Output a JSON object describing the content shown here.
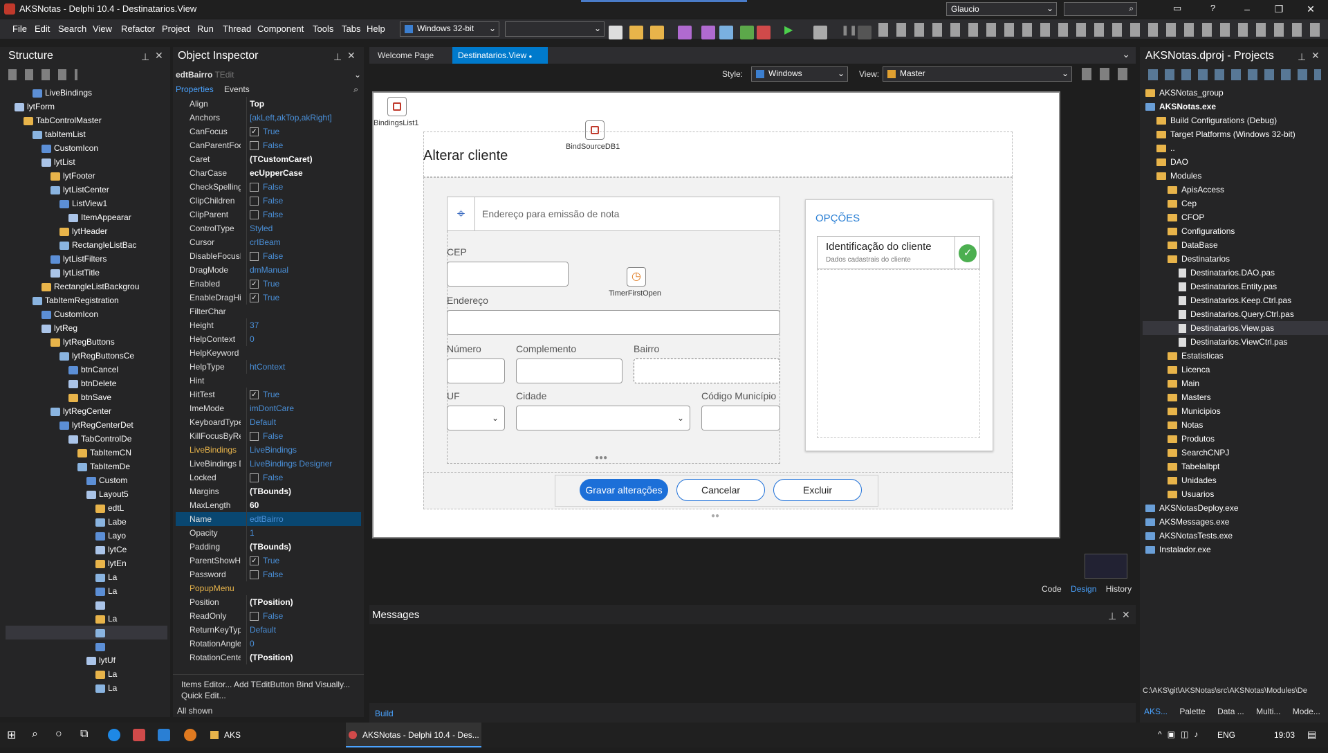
{
  "title_bar": {
    "title": "AKSNotas - Delphi 10.4 - Destinatarios.View",
    "user": "Glaucio",
    "search_placeholder": ""
  },
  "menu": [
    "File",
    "Edit",
    "Search",
    "View",
    "Refactor",
    "Project",
    "Run",
    "Thread",
    "Component",
    "Tools",
    "Tabs",
    "Help"
  ],
  "platform": "Windows 32-bit",
  "structure": {
    "title": "Structure",
    "items": [
      "LiveBindings",
      "lytForm",
      "TabControlMaster",
      "tabItemList",
      "CustomIcon",
      "lytList",
      "lytFooter",
      "lytListCenter",
      "ListView1",
      "ItemAppearar",
      "lytHeader",
      "RectangleListBac",
      "lytListFilters",
      "lytListTitle",
      "RectangleListBackgrou",
      "TabItemRegistration",
      "CustomIcon",
      "lytReg",
      "lytRegButtons",
      "lytRegButtonsCe",
      "btnCancel",
      "btnDelete",
      "btnSave",
      "lytRegCenter",
      "lytRegCenterDet",
      "TabControlDe",
      "TabItemCN",
      "TabItemDe",
      "Custom",
      "Layout5",
      "edtL",
      "Labe",
      "Layo",
      "lytCe",
      "lytEn",
      "La",
      "La",
      "",
      "La",
      "",
      "",
      "lytUf",
      "La",
      "La"
    ]
  },
  "object_inspector": {
    "title": "Object Inspector",
    "object_name": "edtBairro",
    "object_type": "TEdit",
    "tabs": [
      "Properties",
      "Events"
    ],
    "properties": [
      [
        "Align",
        "Top"
      ],
      [
        "Anchors",
        "[akLeft,akTop,akRight]"
      ],
      [
        "CanFocus",
        "True"
      ],
      [
        "CanParentFocus",
        "False"
      ],
      [
        "Caret",
        "(TCustomCaret)"
      ],
      [
        "CharCase",
        "ecUpperCase"
      ],
      [
        "CheckSpelling",
        "False"
      ],
      [
        "ClipChildren",
        "False"
      ],
      [
        "ClipParent",
        "False"
      ],
      [
        "ControlType",
        "Styled"
      ],
      [
        "Cursor",
        "crIBeam"
      ],
      [
        "DisableFocusEffe",
        "False"
      ],
      [
        "DragMode",
        "dmManual"
      ],
      [
        "Enabled",
        "True"
      ],
      [
        "EnableDragHighl",
        "True"
      ],
      [
        "FilterChar",
        ""
      ],
      [
        "Height",
        "37"
      ],
      [
        "HelpContext",
        "0"
      ],
      [
        "HelpKeyword",
        ""
      ],
      [
        "HelpType",
        "htContext"
      ],
      [
        "Hint",
        ""
      ],
      [
        "HitTest",
        "True"
      ],
      [
        "ImeMode",
        "imDontCare"
      ],
      [
        "KeyboardType",
        "Default"
      ],
      [
        "KillFocusByRetur",
        "False"
      ],
      [
        "LiveBindings",
        "LiveBindings"
      ],
      [
        "LiveBindings Des",
        "LiveBindings Designer"
      ],
      [
        "Locked",
        "False"
      ],
      [
        "Margins",
        "(TBounds)"
      ],
      [
        "MaxLength",
        "60"
      ],
      [
        "Name",
        "edtBairro"
      ],
      [
        "Opacity",
        "1"
      ],
      [
        "Padding",
        "(TBounds)"
      ],
      [
        "ParentShowHint",
        "True"
      ],
      [
        "Password",
        "False"
      ],
      [
        "PopupMenu",
        ""
      ],
      [
        "Position",
        "(TPosition)"
      ],
      [
        "ReadOnly",
        "False"
      ],
      [
        "ReturnKeyType",
        "Default"
      ],
      [
        "RotationAngle",
        "0"
      ],
      [
        "RotationCenter",
        "(TPosition)"
      ]
    ],
    "footer_links": "Items Editor... Add TEditButton Bind Visually...",
    "footer_link2": "Quick Edit...",
    "all_shown": "All shown"
  },
  "editor": {
    "tabs": [
      "Welcome Page",
      "Destinatarios.View"
    ],
    "style_label": "Style:",
    "style_value": "Windows",
    "view_label": "View:",
    "view_value": "Master",
    "bottom_tabs": [
      "Code",
      "Design",
      "History"
    ]
  },
  "form": {
    "bindings_list": "BindingsList1",
    "bind_source": "BindSourceDB1",
    "timer": "TimerFirstOpen",
    "title": "Alterar cliente",
    "address_hint": "Endereço para emissão de nota",
    "cep": "CEP",
    "endereco": "Endereço",
    "numero": "Número",
    "complemento": "Complemento",
    "bairro": "Bairro",
    "uf": "UF",
    "cidade": "Cidade",
    "codigo_municipio": "Código Município",
    "opcoes": "OPÇÕES",
    "id_title": "Identificação do cliente",
    "id_subtitle": "Dados cadastrais do cliente",
    "btn_save": "Gravar alterações",
    "btn_cancel": "Cancelar",
    "btn_delete": "Excluir"
  },
  "messages": {
    "title": "Messages",
    "tab": "Build"
  },
  "projects": {
    "title": "AKSNotas.dproj - Projects",
    "items": [
      "AKSNotas_group",
      "AKSNotas.exe",
      "Build Configurations (Debug)",
      "Target Platforms (Windows 32-bit)",
      "..",
      "DAO",
      "Modules",
      "ApisAccess",
      "Cep",
      "CFOP",
      "Configurations",
      "DataBase",
      "Destinatarios",
      "Destinatarios.DAO.pas",
      "Destinatarios.Entity.pas",
      "Destinatarios.Keep.Ctrl.pas",
      "Destinatarios.Query.Ctrl.pas",
      "Destinatarios.View.pas",
      "Destinatarios.ViewCtrl.pas",
      "Estatisticas",
      "Licenca",
      "Main",
      "Masters",
      "Municipios",
      "Notas",
      "Produtos",
      "SearchCNPJ",
      "TabelaIbpt",
      "Unidades",
      "Usuarios",
      "AKSNotasDeploy.exe",
      "AKSMessages.exe",
      "AKSNotasTests.exe",
      "Instalador.exe"
    ],
    "path": "C:\\AKS\\git\\AKSNotas\\src\\AKSNotas\\Modules\\De",
    "bottom_tabs": [
      "AKS...",
      "Palette",
      "Data ...",
      "Multi...",
      "Mode..."
    ]
  },
  "taskbar": {
    "items": [
      "AKS",
      "AKSNotas - Delphi 10.4 - Des..."
    ],
    "lang": "ENG",
    "time": "19:03"
  }
}
